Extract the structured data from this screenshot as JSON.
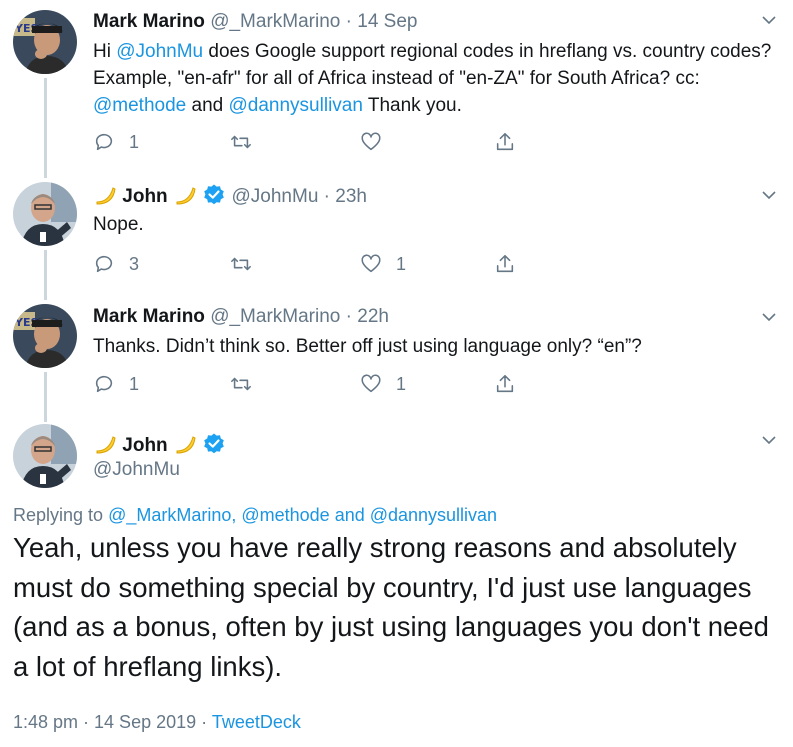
{
  "tweets": [
    {
      "name": "Mark Marino",
      "handle": "@_MarkMarino",
      "sep": " · ",
      "time": "14 Sep",
      "text_parts": [
        "Hi ",
        "@JohnMu",
        " does Google support regional codes in hreflang vs. country codes? Example, \"en-afr\" for all of Africa instead of \"en-ZA\" for South Africa? cc: ",
        "@methode",
        " and ",
        "@dannysullivan",
        " Thank you."
      ],
      "reply_count": "1",
      "retweet_count": "",
      "like_count": ""
    },
    {
      "name": "John",
      "handle": "@JohnMu",
      "sep": " · ",
      "time": "23h",
      "text": "Nope.",
      "reply_count": "3",
      "retweet_count": "",
      "like_count": "1"
    },
    {
      "name": "Mark Marino",
      "handle": "@_MarkMarino",
      "sep": " · ",
      "time": "22h",
      "text": "Thanks. Didn’t think so. Better off just using language only? “en”?",
      "reply_count": "1",
      "retweet_count": "",
      "like_count": "1"
    }
  ],
  "main_tweet": {
    "name": "John",
    "handle": "@JohnMu",
    "replying_label": "Replying to ",
    "replying_mentions": "@_MarkMarino, @methode and @dannysullivan",
    "text": "Yeah, unless you have really strong reasons and absolutely must do something special by country, I'd just use languages (and as a bonus, often by just using languages you don't need a lot of hreflang links).",
    "timestamp": "1:48 pm · 14 Sep 2019 · ",
    "source": "TweetDeck"
  },
  "icons": {
    "reply": "reply-icon",
    "retweet": "retweet-icon",
    "like": "heart-icon",
    "share": "share-icon",
    "caret": "chevron-down-icon",
    "verified": "verified-badge-icon",
    "banana": "banana-emoji-icon"
  },
  "colors": {
    "link": "#1b95e0",
    "secondary_text": "#657786",
    "primary_text": "#14171a",
    "verified": "#1da1f2",
    "thread_line": "#ccd6dd"
  }
}
